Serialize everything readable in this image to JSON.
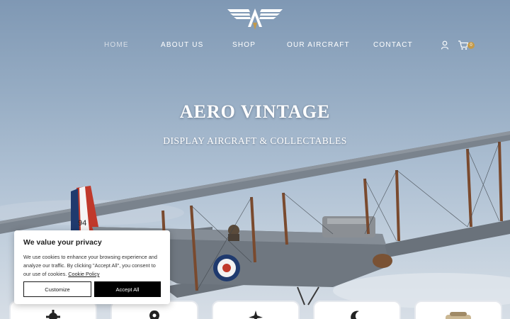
{
  "nav": {
    "items": [
      {
        "label": "HOME",
        "active": true
      },
      {
        "label": "ABOUT US",
        "active": false
      },
      {
        "label": "SHOP",
        "active": false
      },
      {
        "label": "OUR AIRCRAFT",
        "active": false
      },
      {
        "label": "CONTACT",
        "active": false
      }
    ],
    "cart_count": "0"
  },
  "hero": {
    "title": "AERO VINTAGE",
    "subtitle": "DISPLAY AIRCRAFT & COLLECTABLES",
    "serial_number": "94"
  },
  "cookie_banner": {
    "title": "We value your privacy",
    "body": "We use cookies to enhance your browsing experience and analyze our traffic. By clicking \"Accept All\", you consent to our use of cookies.",
    "policy_link": "Cookie Policy",
    "customize_label": "Customize",
    "accept_label": "Accept All"
  },
  "cards": [
    {
      "icon": "gear-icon"
    },
    {
      "icon": "location-pin-icon"
    },
    {
      "icon": "plane-icon"
    },
    {
      "icon": "moon-icon"
    },
    {
      "icon": "aircraft-photo"
    }
  ],
  "colors": {
    "accent_gold": "#c49a4a",
    "roundel_blue": "#1f3a6e",
    "roundel_red": "#c0392b",
    "aircraft_grey": "#6f7780"
  },
  "icons": {
    "logo": "winged-a-logo",
    "user": "user-icon",
    "cart": "cart-icon"
  }
}
